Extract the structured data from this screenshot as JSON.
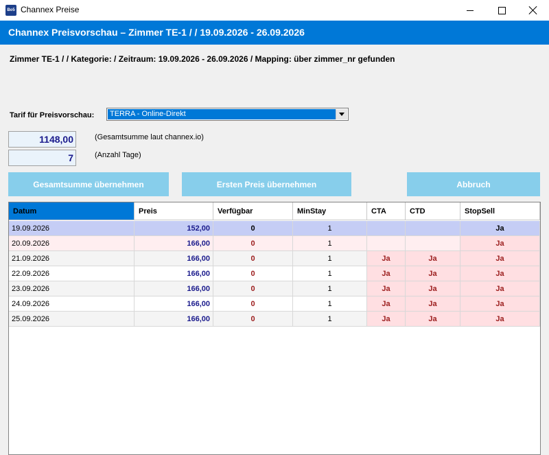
{
  "window": {
    "title": "Channex Preise",
    "icon_text": "Bo5"
  },
  "header": {
    "title": "Channex Preisvorschau  –  Zimmer TE-1 /  / 19.09.2026 - 26.09.2026"
  },
  "info_line": "Zimmer TE-1 /  / Kategorie:  / Zeitraum: 19.09.2026 - 26.09.2026 / Mapping: über zimmer_nr gefunden",
  "tarif": {
    "label": "Tarif für Preisvorschau:",
    "selected": "TERRA - Online-Direkt"
  },
  "summary": {
    "total_value": "1148,00",
    "total_hint": "(Gesamtsumme laut channex.io)",
    "days_value": "7",
    "days_hint": "(Anzahl Tage)"
  },
  "buttons": {
    "apply_total": "Gesamtsumme übernehmen",
    "apply_first": "Ersten Preis übernehmen",
    "cancel": "Abbruch"
  },
  "table": {
    "columns": [
      "Datum",
      "Preis",
      "Verfügbar",
      "MinStay",
      "CTA",
      "CTD",
      "StopSell"
    ],
    "rows": [
      {
        "date": "19.09.2026",
        "price": "152,00",
        "avail": "0",
        "minstay": "1",
        "cta": "",
        "ctd": "",
        "stop": "Ja"
      },
      {
        "date": "20.09.2026",
        "price": "166,00",
        "avail": "0",
        "minstay": "1",
        "cta": "",
        "ctd": "",
        "stop": "Ja"
      },
      {
        "date": "21.09.2026",
        "price": "166,00",
        "avail": "0",
        "minstay": "1",
        "cta": "Ja",
        "ctd": "Ja",
        "stop": "Ja"
      },
      {
        "date": "22.09.2026",
        "price": "166,00",
        "avail": "0",
        "minstay": "1",
        "cta": "Ja",
        "ctd": "Ja",
        "stop": "Ja"
      },
      {
        "date": "23.09.2026",
        "price": "166,00",
        "avail": "0",
        "minstay": "1",
        "cta": "Ja",
        "ctd": "Ja",
        "stop": "Ja"
      },
      {
        "date": "24.09.2026",
        "price": "166,00",
        "avail": "0",
        "minstay": "1",
        "cta": "Ja",
        "ctd": "Ja",
        "stop": "Ja"
      },
      {
        "date": "25.09.2026",
        "price": "166,00",
        "avail": "0",
        "minstay": "1",
        "cta": "Ja",
        "ctd": "Ja",
        "stop": "Ja"
      }
    ]
  },
  "colors": {
    "accent": "#0078d7",
    "button": "#87ceeb",
    "selected_row": "#c5cdf5",
    "row_pink": "#ffeef0",
    "flag_pink": "#ffdfe2",
    "alt_row": "#f4f4f4",
    "price_text": "#1a1a8c",
    "flag_text": "#9b1c1c"
  }
}
